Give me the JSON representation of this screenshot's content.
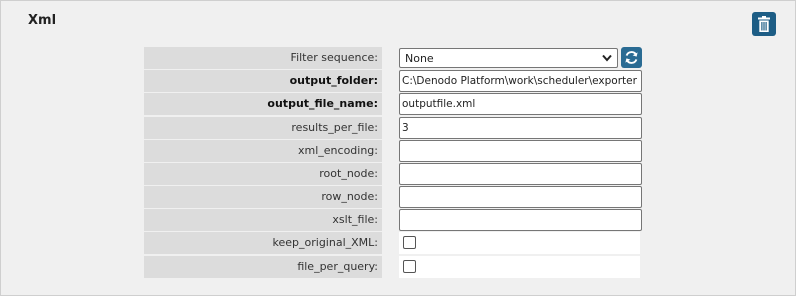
{
  "panel": {
    "title": "Xml",
    "delete_icon": "trash-icon"
  },
  "fields": {
    "filter_sequence": {
      "label": "Filter sequence:",
      "value": "None",
      "refresh_icon": "refresh-icon"
    },
    "output_folder": {
      "label": "output_folder:",
      "value": "C:\\Denodo Platform\\work\\scheduler\\exporter"
    },
    "output_file_name": {
      "label": "output_file_name:",
      "value": "outputfile.xml"
    },
    "results_per_file": {
      "label": "results_per_file:",
      "value": "3"
    },
    "xml_encoding": {
      "label": "xml_encoding:",
      "value": ""
    },
    "root_node": {
      "label": "root_node:",
      "value": ""
    },
    "row_node": {
      "label": "row_node:",
      "value": ""
    },
    "xslt_file": {
      "label": "xslt_file:",
      "value": ""
    },
    "keep_original_xml": {
      "label": "keep_original_XML:",
      "checked": false
    },
    "file_per_query": {
      "label": "file_per_query:",
      "checked": false
    }
  }
}
